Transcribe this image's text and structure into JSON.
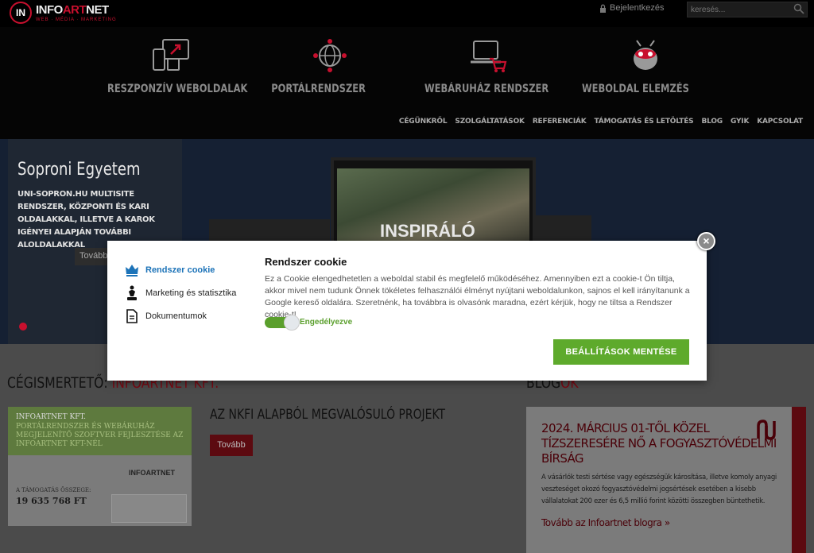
{
  "header": {
    "logo_mark": "IN",
    "logo_name_a": "INFO",
    "logo_name_b": "ART",
    "logo_name_c": "NET",
    "logo_sub": "WEB · MÉDIA · MARKETING",
    "login_label": "Bejelentkezés",
    "search_placeholder": "keresés..."
  },
  "services": [
    {
      "label": "RESZPONZÍV WEBOLDALAK",
      "icon": "responsive-devices-icon"
    },
    {
      "label": "PORTÁLRENDSZER",
      "icon": "globe-network-icon"
    },
    {
      "label": "WEBÁRUHÁZ RENDSZER",
      "icon": "laptop-cart-icon"
    },
    {
      "label": "WEBOLDAL ELEMZÉS",
      "icon": "bug-analysis-icon"
    }
  ],
  "nav": [
    "CÉGÜNKRŐL",
    "SZOLGÁLTATÁSOK",
    "REFERENCIÁK",
    "TÁMOGATÁS ÉS LETÖLTÉS",
    "BLOG",
    "GYIK",
    "KAPCSOLAT"
  ],
  "hero": {
    "title": "Soproni Egyetem",
    "description": "UNI-SOPRON.HU MULTISITE RENDSZER, KÖZPONTI ÉS KARI OLDALAKKAL, ILLETVE A KAROK IGÉNYEI ALAPJÁN TOVÁBBI ALOLDALAKKAL",
    "button": "Tovább",
    "screen_text": "INSPIRÁLÓ"
  },
  "content": {
    "company_title_a": "CÉGISMERTETŐ: ",
    "company_title_b": "INFOARTNET KFT.",
    "card_title": "INFOARTNET KFT.",
    "card_subtitle": "PORTÁLRENDSZER ÉS WEBÁRUHÁZ MEGJELENÍTŐ SZOFTVER FEJLESZTÉSE AZ INFOARTNET KFT-NÉL",
    "card_logo": "INFOARTNET",
    "card_amount_label": "A TÁMOGATÁS ÖSSZEGE:",
    "card_amount": "19 635 768 FT",
    "project_title": "AZ NKFI ALAPBÓL MEGVALÓSULÓ PROJEKT",
    "project_button": "Tovább",
    "blog_title_a": "BLOG",
    "blog_title_b": "OK",
    "blog_post_title": "2024. MÁRCIUS 01-TŐL KÖZEL TÍZSZERESÉRE NŐ A FOGYASZTÓVÉDELMI BÍRSÁG",
    "blog_post_text": "A vásárlók testi sértése vagy egészségük károsítása, illetve komoly anyagi veszteséget okozó fogyasztóvédelmi jogsértések esetében a kisebb vállalatokat 200 ezer és 6,5 millió forint közötti összegben büntethetik.",
    "blog_more": "Tovább az Infoartnet blogra »"
  },
  "cookie_modal": {
    "close": "×",
    "categories": [
      {
        "label": "Rendszer cookie",
        "icon": "crown-icon",
        "active": true
      },
      {
        "label": "Marketing és statisztika",
        "icon": "chess-piece-icon",
        "active": false
      },
      {
        "label": "Dokumentumok",
        "icon": "document-icon",
        "active": false
      }
    ],
    "title": "Rendszer cookie",
    "description": "Ez a Cookie elengedhetetlen a weboldal stabil és megfelelő működéséhez. Amennyiben ezt a cookie-t Ön tiltja, akkor mivel nem tudunk Önnek tökéletes felhasználói élményt nyújtani weboldalunkon, sajnos el kell irányítanunk a Google kereső oldalára. Szeretnénk, ha továbbra is olvasónk maradna, ezért kérjük, hogy ne tiltsa a Rendszer cookie-t!",
    "toggle_label": "Engedélyezve",
    "toggle_on": true,
    "save_button": "BEÁLLÍTÁSOK MENTÉSE"
  },
  "colors": {
    "brand_red": "#c8102e",
    "accent_green": "#5eaa2c",
    "link_blue": "#1c73b8"
  }
}
